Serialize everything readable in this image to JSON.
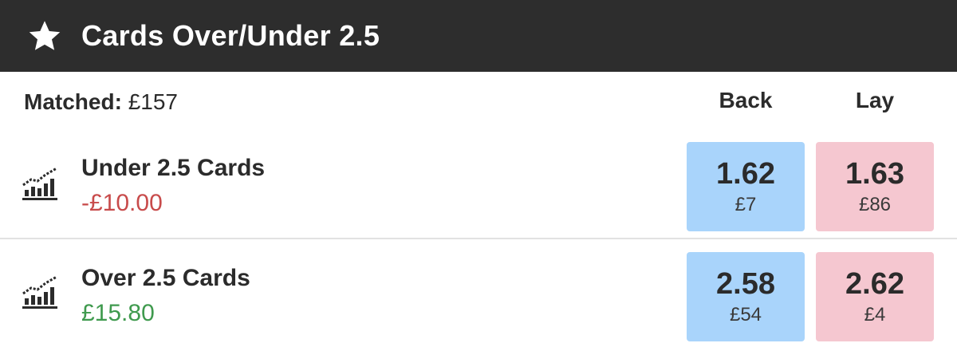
{
  "header": {
    "icon": "star-icon",
    "title": "Cards Over/Under 2.5"
  },
  "market": {
    "matched_label": "Matched:",
    "matched_value": "£157",
    "back_label": "Back",
    "lay_label": "Lay"
  },
  "runners": [
    {
      "icon": "market-chart-icon",
      "name": "Under 2.5 Cards",
      "pl": "-£10.00",
      "pl_color": "#c84b4b",
      "back": {
        "price": "1.62",
        "size": "£7"
      },
      "lay": {
        "price": "1.63",
        "size": "£86"
      }
    },
    {
      "icon": "market-chart-icon",
      "name": "Over 2.5 Cards",
      "pl": "£15.80",
      "pl_color": "#3f9a4e",
      "back": {
        "price": "2.58",
        "size": "£54"
      },
      "lay": {
        "price": "2.62",
        "size": "£4"
      }
    }
  ],
  "colors": {
    "header_bg": "#2d2d2d",
    "back_bg": "#a9d4fb",
    "lay_bg": "#f5c7d0"
  }
}
